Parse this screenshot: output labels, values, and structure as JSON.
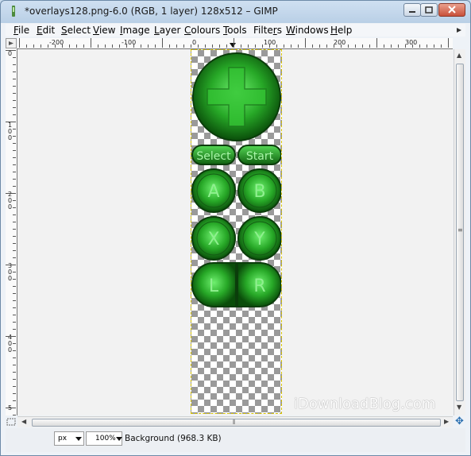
{
  "window": {
    "title": "*overlays128.png-6.0 (RGB, 1 layer) 128x512 – GIMP"
  },
  "menu": [
    {
      "label": "File",
      "mnemonic": "F",
      "rest": "ile"
    },
    {
      "label": "Edit",
      "mnemonic": "E",
      "rest": "dit"
    },
    {
      "label": "Select",
      "mnemonic": "S",
      "rest": "elect"
    },
    {
      "label": "View",
      "mnemonic": "V",
      "rest": "iew"
    },
    {
      "label": "Image",
      "mnemonic": "I",
      "rest": "mage"
    },
    {
      "label": "Layer",
      "mnemonic": "L",
      "rest": "ayer"
    },
    {
      "label": "Colours",
      "mnemonic": "C",
      "rest": "olours"
    },
    {
      "label": "Tools",
      "mnemonic": "T",
      "rest": "ools"
    },
    {
      "label": "Filters",
      "mnemonic": "r",
      "rest": ""
    },
    {
      "label": "Windows",
      "mnemonic": "W",
      "rest": "indows"
    },
    {
      "label": "Help",
      "mnemonic": "H",
      "rest": "elp"
    }
  ],
  "ruler": {
    "horizontal_labels": [
      "-200",
      "-100",
      "0",
      "100",
      "200",
      "300"
    ],
    "vertical_labels": [
      "0",
      "100",
      "200",
      "300",
      "400",
      "5"
    ]
  },
  "canvas": {
    "gamepad": {
      "dpad_label": "",
      "select_label": "Select",
      "start_label": "Start",
      "a_label": "A",
      "b_label": "B",
      "x_label": "X",
      "y_label": "Y",
      "l_label": "L",
      "r_label": "R"
    },
    "watermark": "iDownloadBlog.com"
  },
  "statusbar": {
    "unit": "px",
    "zoom": "100%",
    "layer_info": "Background (968.3 KB)"
  },
  "colors": {
    "button_green": "#2fb52f",
    "button_dark": "#0b4a0b",
    "label_green": "#7ee07e"
  }
}
